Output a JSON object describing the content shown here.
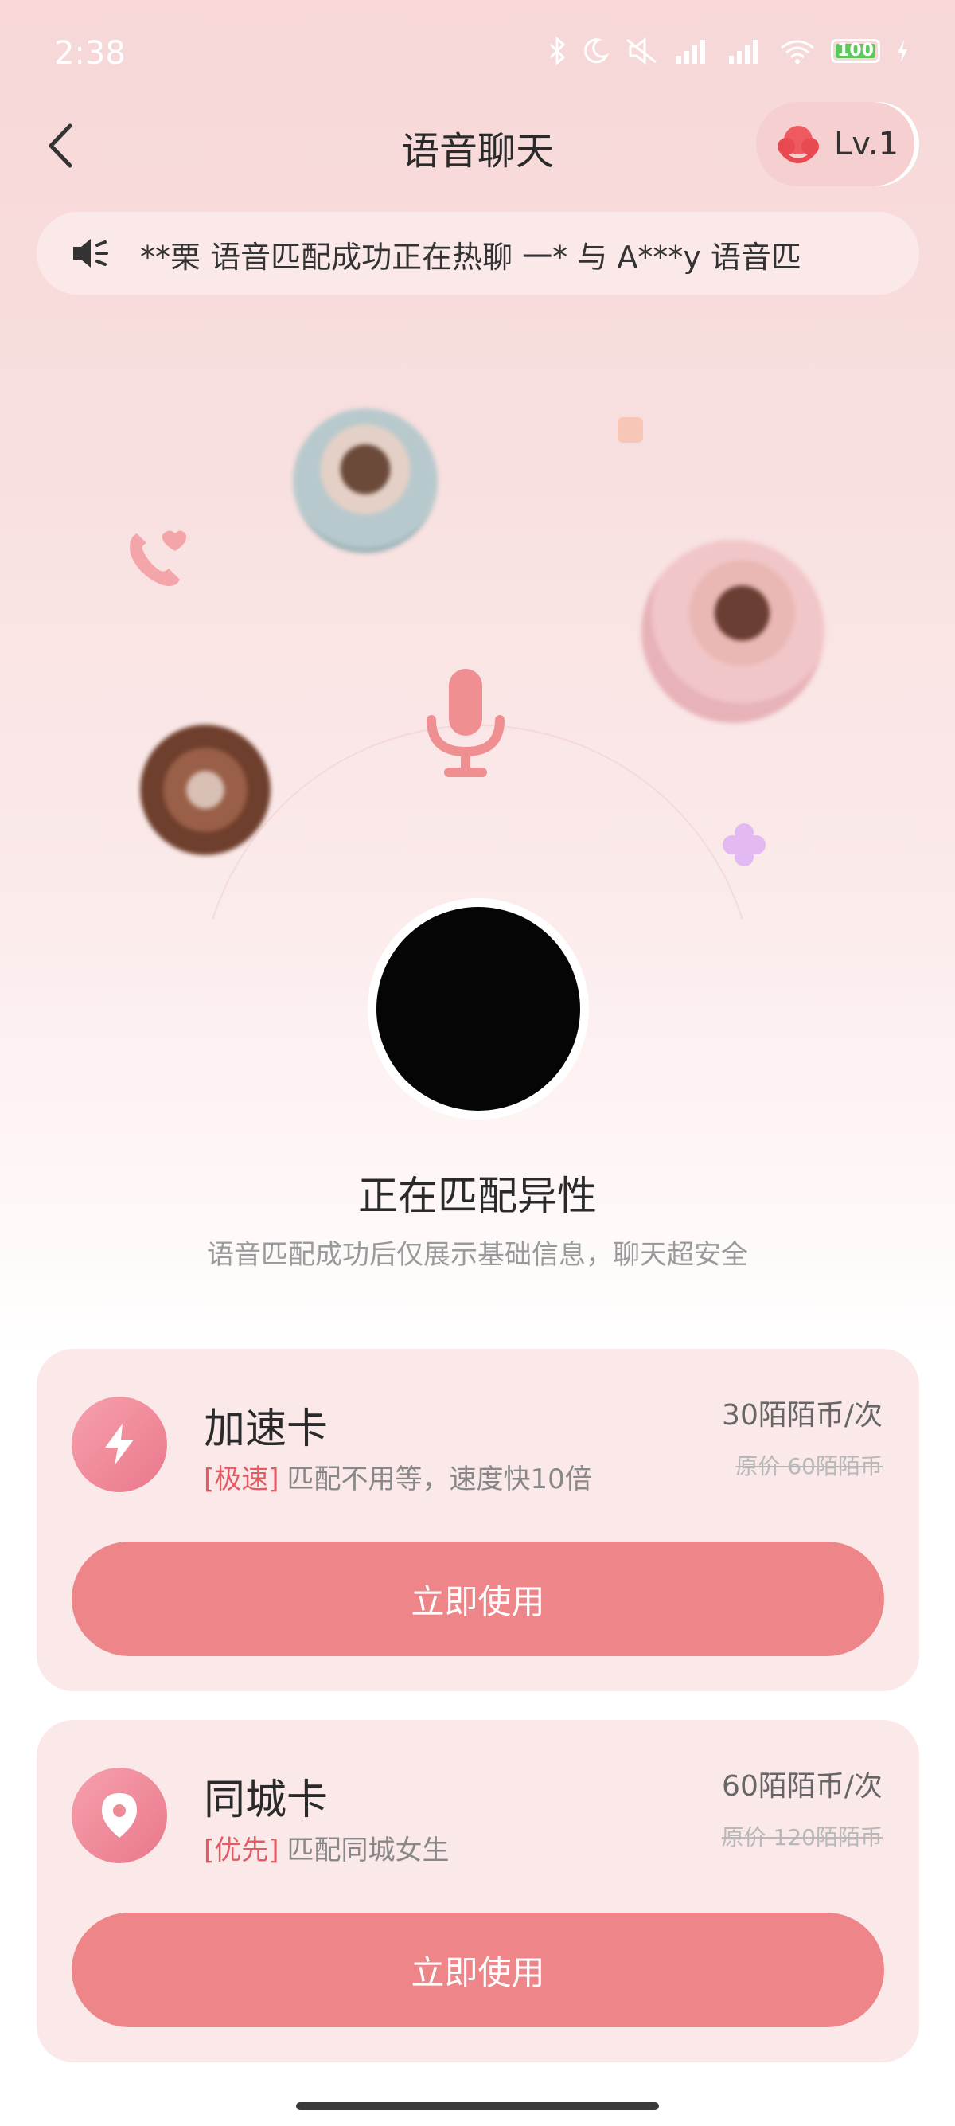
{
  "status_bar": {
    "time": "2:38",
    "battery_level": "100"
  },
  "header": {
    "title": "语音聊天",
    "level_label": "Lv.1"
  },
  "marquee": {
    "text": "**栗 语音匹配成功正在热聊   一* 与 A***y 语音匹"
  },
  "matching": {
    "title": "正在匹配异性",
    "subtitle": "语音匹配成功后仅展示基础信息，聊天超安全"
  },
  "cards": [
    {
      "name": "加速卡",
      "tag": "[极速]",
      "description": "匹配不用等，速度快10倍",
      "price": "30陌陌币/次",
      "original_price": "原价 60陌陌币",
      "button_label": "立即使用",
      "icon": "lightning-icon"
    },
    {
      "name": "同城卡",
      "tag": "[优先]",
      "description": "匹配同城女生",
      "price": "60陌陌币/次",
      "original_price": "原价 120陌陌币",
      "button_label": "立即使用",
      "icon": "location-pin-icon"
    }
  ],
  "colors": {
    "accent": "#ee8689",
    "tag_red": "#e35a62",
    "card_bg": "#fbe9e9"
  }
}
